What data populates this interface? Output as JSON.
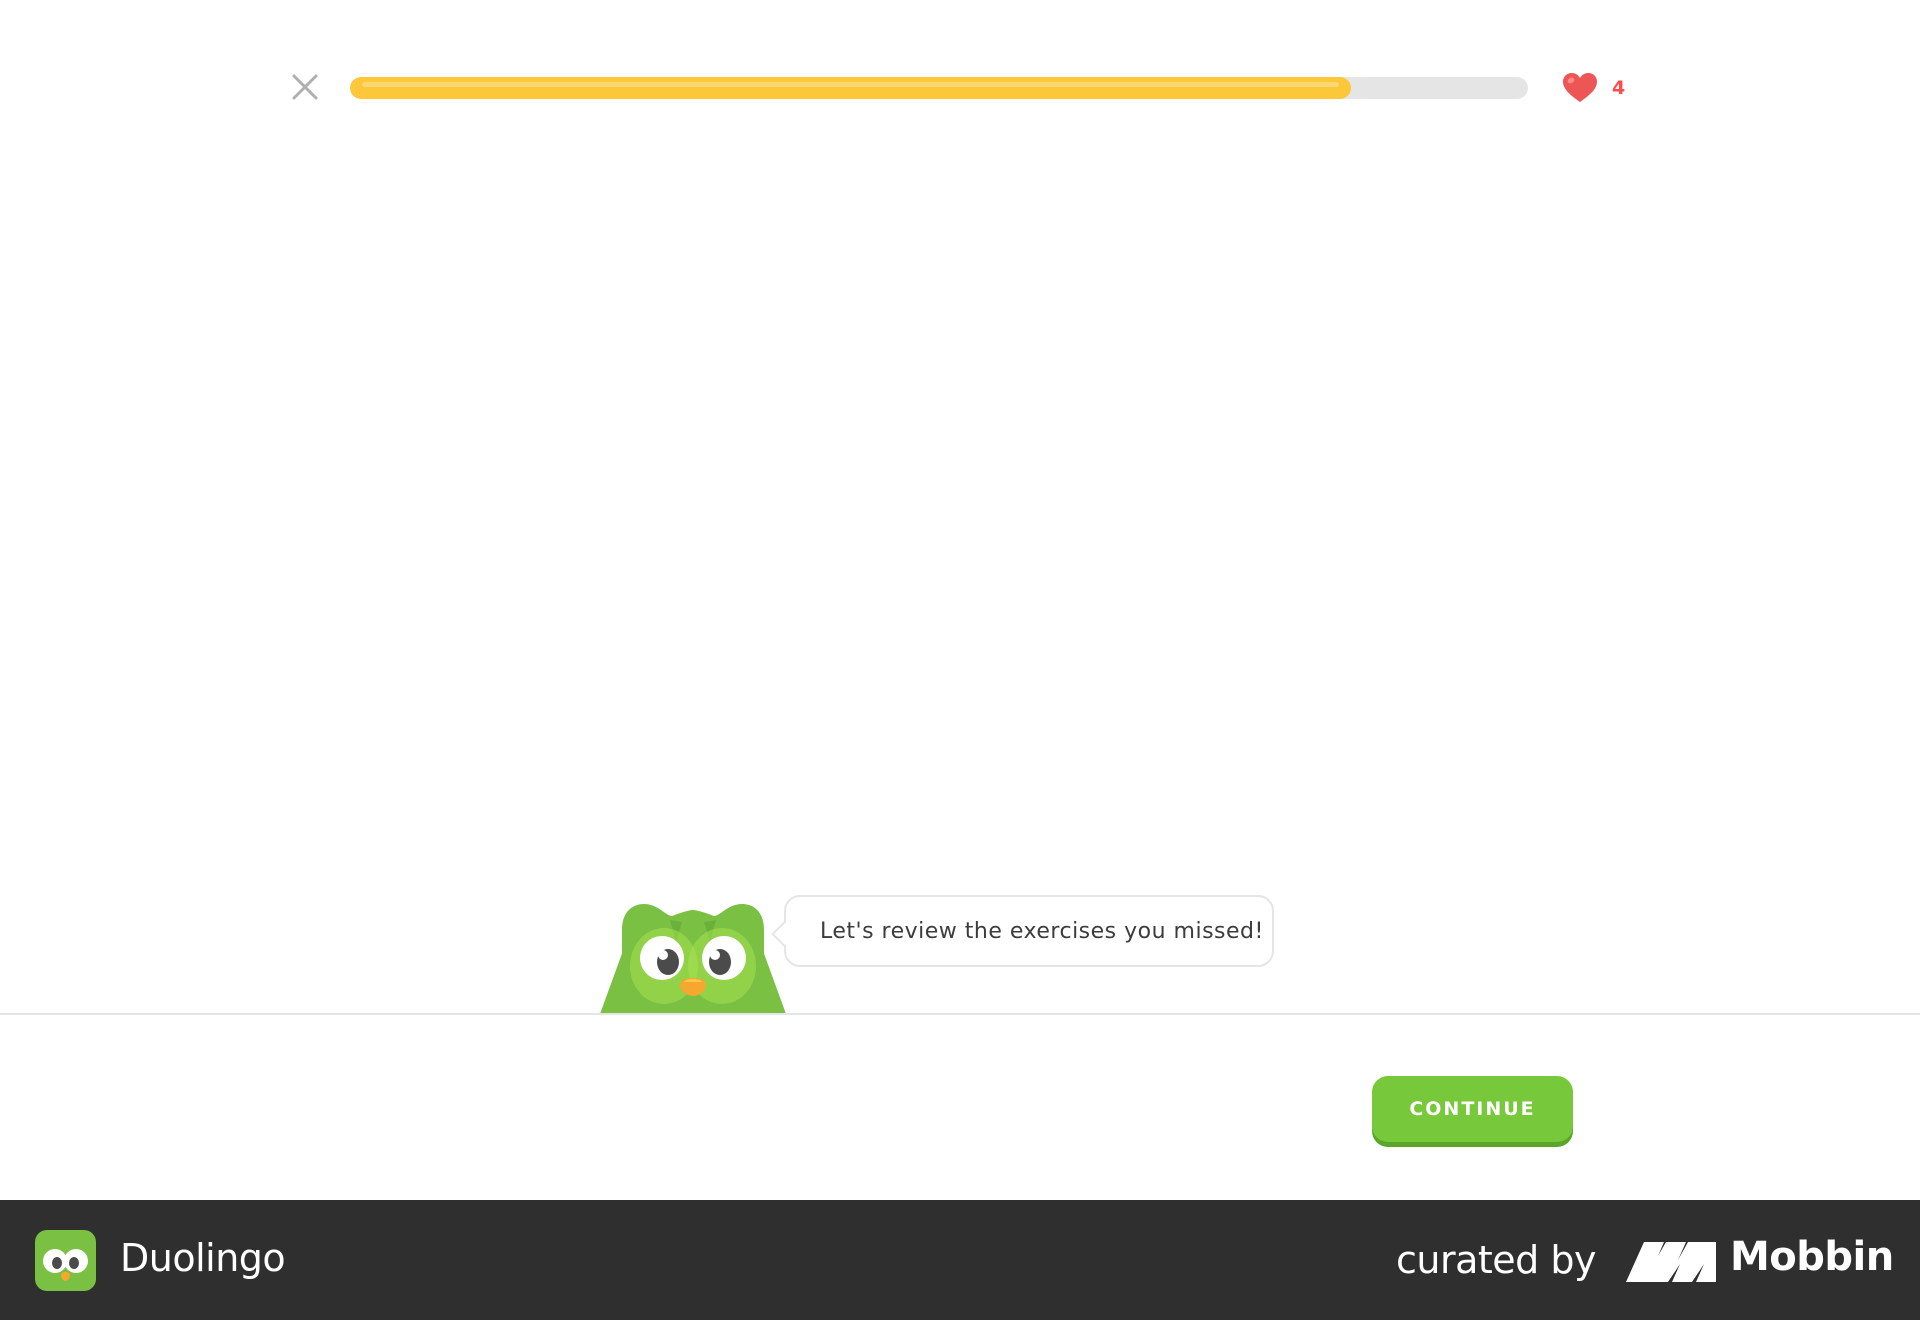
{
  "lesson": {
    "progress_percent": 85,
    "hearts_count": "4"
  },
  "coach": {
    "message": "Let's review the exercises you missed!"
  },
  "footer": {
    "continue_label": "CONTINUE"
  },
  "branding": {
    "app_name": "Duolingo",
    "curated_by": "curated by",
    "platform_name": "Mobbin"
  },
  "colors": {
    "progress": "#fcc83a",
    "heart": "#ff4b4b",
    "button": "#78c83c",
    "owl": "#7ac143"
  },
  "icons": {
    "close": "close-icon",
    "heart": "heart-icon",
    "owl": "owl-mascot-icon"
  }
}
